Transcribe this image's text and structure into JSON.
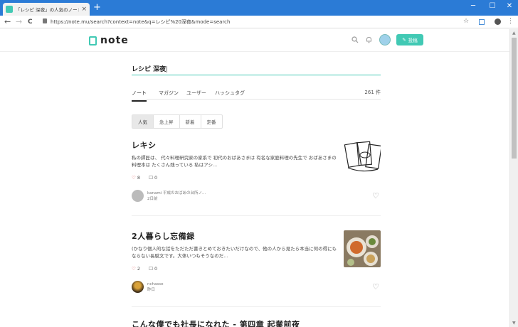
{
  "browser": {
    "tab_title": "「レシピ 深夜」の人気のノート一覧",
    "tab_close": "×",
    "new_tab": "+",
    "win_min": "─",
    "win_max": "☐",
    "win_close": "✕",
    "back": "←",
    "forward": "→",
    "reload": "C",
    "url": "https://note.mu/search?context=note&q=レシピ%20深夜&mode=search",
    "star": "☆",
    "menu": "⋮"
  },
  "header": {
    "logo_text": "note",
    "post_label": "投稿",
    "search_icon": "search-icon",
    "bell_icon": "bell-icon",
    "accent": "#41c9b4"
  },
  "search": {
    "query": "レシピ 深夜"
  },
  "tabs": {
    "items": [
      "ノート",
      "マガジン",
      "ユーザー",
      "ハッシュタグ"
    ],
    "count": "261 件"
  },
  "sort": {
    "items": [
      "人気",
      "急上昇",
      "新着",
      "定番"
    ]
  },
  "articles": [
    {
      "title": "レキシ",
      "excerpt": "私の師匠は、 代々料理研究家の家系で 初代のおばあさまは 有名な家庭料理の先生で おばあさまの料理本は たくさん残っている 私はアシ...",
      "likes": "8",
      "comments": "0",
      "author": "kanami 平成のおばあの台所ノ...",
      "date": "2日前"
    },
    {
      "title": "2人暮らし忘備録",
      "excerpt": "(かなり個人的な話をただただ書きとめておきたいだけなので、他の人から見たら本当に何の得にもならない長駄文です。大体いつもそうなのだ...",
      "likes": "2",
      "comments": "0",
      "author": "nchasse",
      "date": "昨日"
    },
    {
      "title": "こんな僕でも社長になれた - 第四章 起業前夜"
    }
  ]
}
